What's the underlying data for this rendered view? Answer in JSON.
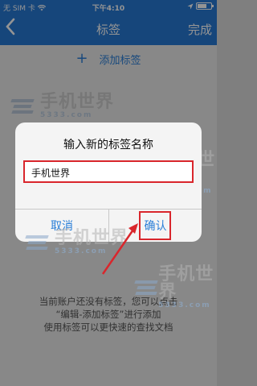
{
  "status_bar": {
    "carrier": "无 SIM 卡",
    "time": "下午4:10"
  },
  "nav": {
    "back_icon": "chevron-left-icon",
    "title": "标签",
    "done_label": "完成"
  },
  "add_tag": {
    "icon": "plus-icon",
    "label": "添加标签"
  },
  "empty_state": {
    "line1": "当前账户还没有标签，您可以点击",
    "line2": "“编辑-添加标签”进行添加",
    "line3": "使用标签可以更快速的查找文档"
  },
  "watermark": {
    "title": "手机世界",
    "subtitle": "5333.com"
  },
  "dialog": {
    "title": "输入新的标签名称",
    "input_value": "手机世界",
    "cancel_label": "取消",
    "confirm_label": "确认"
  },
  "colors": {
    "accent": "#2779d4",
    "highlight": "#d9262c"
  }
}
